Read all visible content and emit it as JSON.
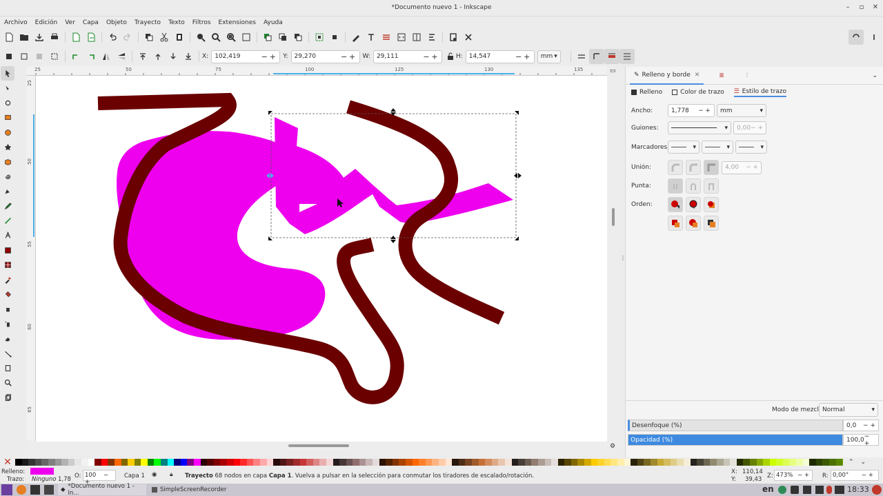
{
  "window": {
    "title": "*Documento nuevo 1 - Inkscape"
  },
  "menu": [
    "Archivo",
    "Edición",
    "Ver",
    "Capa",
    "Objeto",
    "Trayecto",
    "Texto",
    "Filtros",
    "Extensiones",
    "Ayuda"
  ],
  "selector": {
    "x_label": "X:",
    "x_value": "102,419",
    "y_label": "Y:",
    "y_value": "29,270",
    "w_label": "W:",
    "w_value": "29,111",
    "h_label": "H:",
    "h_value": "14,547",
    "unit": "mm"
  },
  "ruler_top": [
    "25",
    "50",
    "75",
    "100",
    "125",
    "130",
    "135"
  ],
  "ruler_left": [
    "25",
    "50",
    "55",
    "60",
    "65"
  ],
  "panel": {
    "tabs": [
      "Relleno y borde",
      "",
      ""
    ],
    "subtabs": [
      "Relleno",
      "Color de trazo",
      "Estilo de trazo"
    ],
    "ancho_label": "Ancho:",
    "ancho_value": "1,778",
    "ancho_unit": "mm",
    "guiones_label": "Guiones:",
    "guiones_value": "0,00",
    "marcadores_label": "Marcadores:",
    "union_label": "Unión:",
    "union_value": "4,00",
    "punta_label": "Punta:",
    "orden_label": "Orden:",
    "blend_label": "Modo de mezcla:",
    "blend_value": "Normal",
    "blur_label": "Desenfoque (%)",
    "blur_value": "0,0",
    "opacity_label": "Opacidad (%)",
    "opacity_value": "100,0",
    "opacity_level": 1.0
  },
  "status": {
    "fill_label": "Relleno:",
    "stroke_label": "Trazo:",
    "stroke_value": "Ninguno",
    "stroke_width": "1,78",
    "o_label": "O:",
    "o_value": "100",
    "layer": "Capa 1",
    "message_bold": "Trayecto",
    "message": "68 nodos en capa",
    "message_layer": "Capa 1",
    "message_tail": ". Vuelva a pulsar en la selección para conmutar los tiradores de escalado/rotación.",
    "x_coord": "110,14",
    "y_coord": "39,43",
    "x_label": "X:",
    "y_label": "Y:",
    "z_label": "Z:",
    "zoom": "473%",
    "r_label": "R:",
    "rotation": "0,00°"
  },
  "taskbar": {
    "items": [
      "*Documento nuevo 1 - In...",
      "SimpleScreenRecorder"
    ],
    "lang": "en",
    "clock": "18:33"
  },
  "colors": {
    "magenta": "#ee00ee",
    "maroon": "#6b0000",
    "accent": "#4a8ee0"
  }
}
